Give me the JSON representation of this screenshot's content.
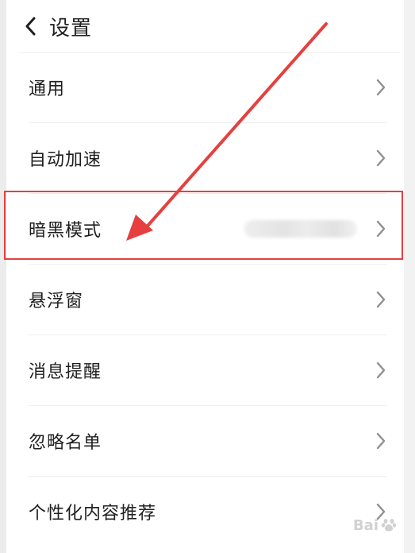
{
  "header": {
    "title": "设置",
    "back_icon": "chevron-left-icon"
  },
  "settings": {
    "items": [
      {
        "label": "通用"
      },
      {
        "label": "自动加速"
      },
      {
        "label": "暗黑模式",
        "value": ""
      },
      {
        "label": "悬浮窗"
      },
      {
        "label": "消息提醒"
      },
      {
        "label": "忽略名单"
      },
      {
        "label": "个性化内容推荐"
      }
    ]
  },
  "annotation": {
    "color": "#e5403f"
  },
  "watermark": {
    "text": "Bai",
    "logo_icon": "baidu-paw-icon"
  }
}
